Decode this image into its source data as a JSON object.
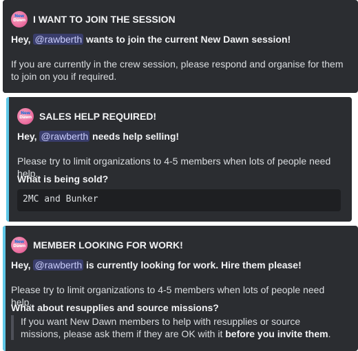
{
  "colors": {
    "embed_bg": "#2b2d31",
    "accent_1": "#2b2d31",
    "accent_2": "#5fc8e8",
    "accent_3": "#5fc8e8",
    "mention_bg": "#3c4270"
  },
  "avatar_text": [
    "New",
    "Dawn"
  ],
  "embeds": [
    {
      "author": "I WANT TO JOIN THE SESSION",
      "greeting": "Hey,",
      "mention": "@rawberth",
      "headline": "wants to join the current New Dawn session!",
      "body": "If you are currently in the crew session, please respond and organise for them to join on you if required."
    },
    {
      "author": "SALES HELP REQUIRED!",
      "greeting": "Hey,",
      "mention": "@rawberth",
      "headline": "needs help selling!",
      "body": "Please try to limit organizations to 4-5 members when lots of people need help.",
      "question": "What is being sold?",
      "code": "2MC and Bunker"
    },
    {
      "author": "MEMBER LOOKING FOR WORK!",
      "greeting": "Hey,",
      "mention": "@rawberth",
      "headline": "is currently looking for work. Hire them please!",
      "body": "Please try to limit organizations to 4-5 members when lots of people need help.",
      "question": "What about resupplies and source missions?",
      "quote_text": "If you want New Dawn members to help with resupplies or source missions, please ask them if they are OK with it",
      "quote_bold": "before you invite them",
      "quote_end": "."
    }
  ]
}
